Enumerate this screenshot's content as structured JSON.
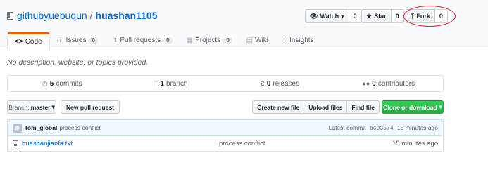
{
  "repo": {
    "owner": "githubyuebuqun",
    "separator": "/",
    "name": "huashan1105"
  },
  "actions": {
    "watch_label": "Watch",
    "watch_count": "0",
    "star_label": "Star",
    "star_count": "0",
    "fork_label": "Fork",
    "fork_count": "0"
  },
  "tabs": [
    {
      "label": "Code",
      "icon": "code-icon",
      "count": ""
    },
    {
      "label": "Issues",
      "icon": "issue-icon",
      "count": "0"
    },
    {
      "label": "Pull requests",
      "icon": "pull-request-icon",
      "count": "0"
    },
    {
      "label": "Projects",
      "icon": "project-icon",
      "count": "0"
    },
    {
      "label": "Wiki",
      "icon": "book-icon",
      "count": ""
    },
    {
      "label": "Insights",
      "icon": "graph-icon",
      "count": ""
    }
  ],
  "description": "No description, website, or topics provided.",
  "summary": {
    "commits_count": "5",
    "commits_label": "commits",
    "branch_count": "1",
    "branch_label": "branch",
    "releases_count": "0",
    "releases_label": "releases",
    "contributors_count": "0",
    "contributors_label": "contributors"
  },
  "toolbar": {
    "branch_prefix": "Branch:",
    "branch_value": "master",
    "new_pr": "New pull request",
    "create_file": "Create new file",
    "upload_files": "Upload files",
    "find_file": "Find file",
    "clone": "Clone or download"
  },
  "commit": {
    "author": "tom_global",
    "message": "process conflict",
    "latest_label": "Latest commit",
    "sha": "b693574",
    "age": "15 minutes ago"
  },
  "files": [
    {
      "name": "huashanjianfa.txt",
      "message": "process conflict",
      "age": "15 minutes ago"
    }
  ],
  "colors": {
    "accent_tab": "#e36209",
    "link": "#0366d6",
    "clone_green": "#28a745",
    "annotation_circle": "#e0202a"
  }
}
